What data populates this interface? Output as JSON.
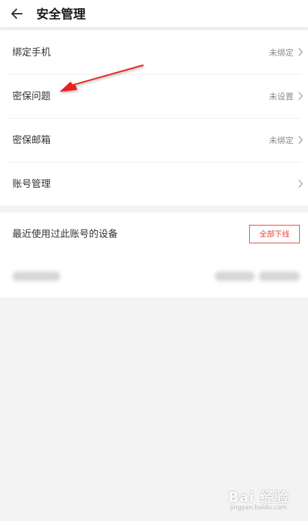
{
  "header": {
    "title": "安全管理",
    "back_icon": "back-arrow-icon"
  },
  "settings": {
    "items": [
      {
        "label": "绑定手机",
        "status": "未绑定"
      },
      {
        "label": "密保问题",
        "status": "未设置"
      },
      {
        "label": "密保邮箱",
        "status": "未绑定"
      },
      {
        "label": "账号管理",
        "status": ""
      }
    ]
  },
  "devices": {
    "title": "最近使用过此账号的设备",
    "logout_all_label": "全部下线"
  },
  "annotation": {
    "color": "#e8221c",
    "icon": "red-pointer-arrow"
  },
  "watermark": {
    "main": "Bai 经验",
    "sub": "jingyan.baidu.com"
  }
}
